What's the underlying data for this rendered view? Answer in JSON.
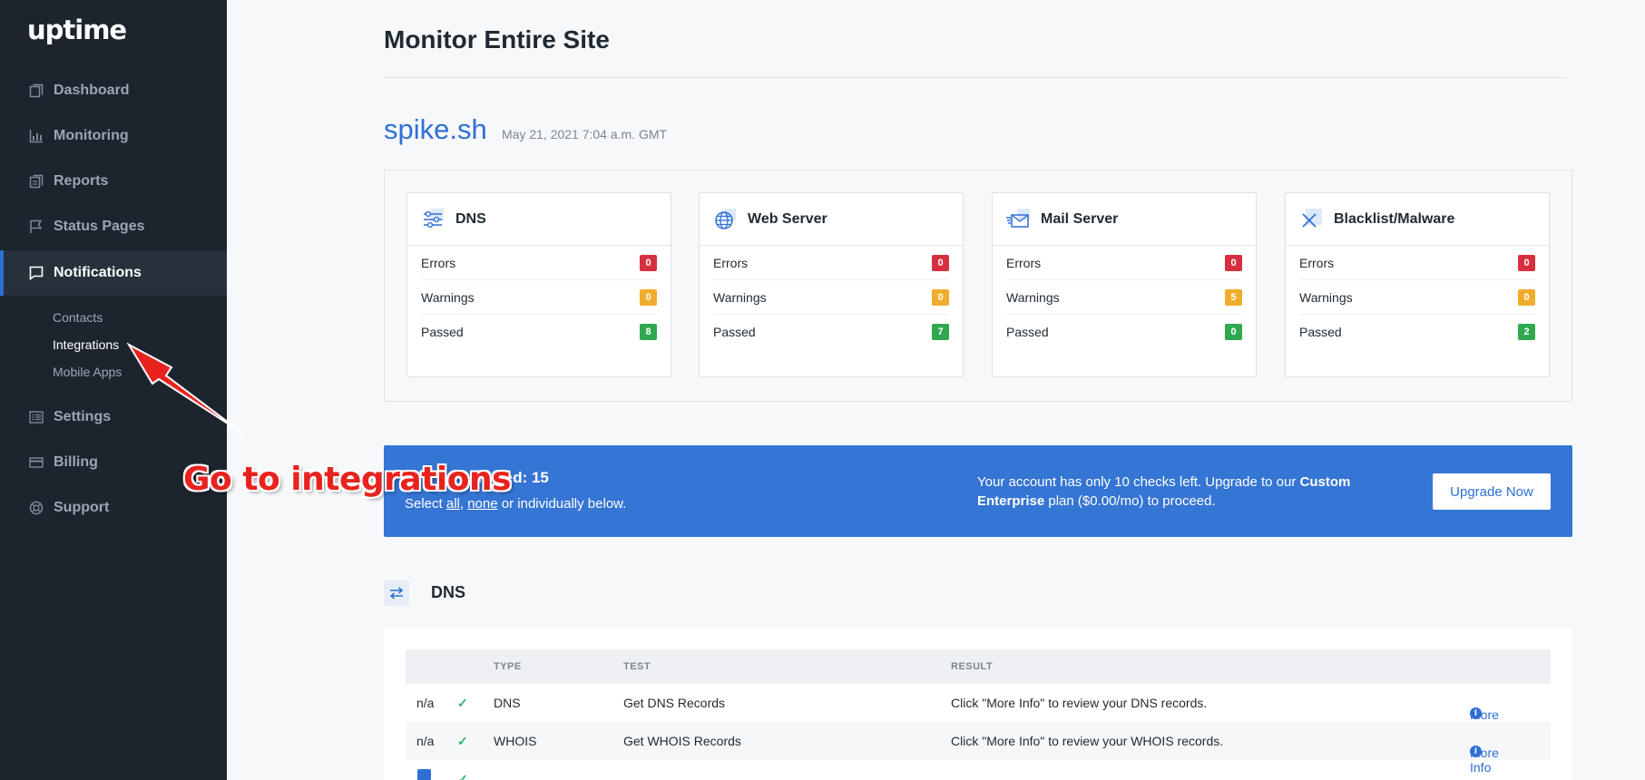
{
  "app": {
    "logo": "uptime"
  },
  "sidebar": {
    "items": [
      {
        "label": "Dashboard",
        "icon": "dashboard-icon"
      },
      {
        "label": "Monitoring",
        "icon": "chart-icon"
      },
      {
        "label": "Reports",
        "icon": "reports-icon"
      },
      {
        "label": "Status Pages",
        "icon": "flag-icon"
      },
      {
        "label": "Notifications",
        "icon": "chat-icon",
        "active": true
      },
      {
        "label": "Settings",
        "icon": "list-icon"
      },
      {
        "label": "Billing",
        "icon": "card-icon"
      },
      {
        "label": "Support",
        "icon": "lifebuoy-icon"
      }
    ],
    "subitems": [
      "Contacts",
      "Integrations",
      "Mobile Apps"
    ]
  },
  "header": {
    "title": "Monitor Entire Site",
    "domain": "spike.sh",
    "timestamp": "May 21, 2021 7:04 a.m. GMT"
  },
  "cards": [
    {
      "title": "DNS",
      "icon": "sliders-icon",
      "rows": [
        {
          "label": "Errors",
          "value": "0",
          "color": "#d6303f"
        },
        {
          "label": "Warnings",
          "value": "0",
          "color": "#f0ad2d"
        },
        {
          "label": "Passed",
          "value": "8",
          "color": "#2fa84f"
        }
      ]
    },
    {
      "title": "Web Server",
      "icon": "globe-icon",
      "rows": [
        {
          "label": "Errors",
          "value": "0",
          "color": "#d6303f"
        },
        {
          "label": "Warnings",
          "value": "0",
          "color": "#f0ad2d"
        },
        {
          "label": "Passed",
          "value": "7",
          "color": "#2fa84f"
        }
      ]
    },
    {
      "title": "Mail Server",
      "icon": "mail-icon",
      "rows": [
        {
          "label": "Errors",
          "value": "0",
          "color": "#d6303f"
        },
        {
          "label": "Warnings",
          "value": "5",
          "color": "#f0ad2d"
        },
        {
          "label": "Passed",
          "value": "0",
          "color": "#2fa84f"
        }
      ]
    },
    {
      "title": "Blacklist/Malware",
      "icon": "blacklist-icon",
      "rows": [
        {
          "label": "Errors",
          "value": "0",
          "color": "#d6303f"
        },
        {
          "label": "Warnings",
          "value": "0",
          "color": "#f0ad2d"
        },
        {
          "label": "Passed",
          "value": "2",
          "color": "#2fa84f"
        }
      ]
    }
  ],
  "banner": {
    "title_visible": "elected: 15",
    "select_prefix": "Select ",
    "all": "all",
    "sep": ", ",
    "none": "none",
    "select_suffix": " or individually below.",
    "msg_start": "Your account has only 10 checks left. Upgrade to our ",
    "msg_bold": "Custom Enterprise",
    "msg_end": " plan ($0.00/mo) to proceed.",
    "button": "Upgrade Now"
  },
  "dns_section": {
    "title": "DNS",
    "headers": {
      "type": "TYPE",
      "test": "TEST",
      "result": "RESULT"
    },
    "rows": [
      {
        "status": "n/a",
        "type": "DNS",
        "test": "Get DNS Records",
        "result": "Click \"More Info\" to review your DNS records.",
        "more": "More Info"
      },
      {
        "status": "n/a",
        "type": "WHOIS",
        "test": "Get WHOIS Records",
        "result": "Click \"More Info\" to review your WHOIS records.",
        "more": "More Info"
      }
    ]
  },
  "annotation": {
    "text": "Go to integrations"
  }
}
